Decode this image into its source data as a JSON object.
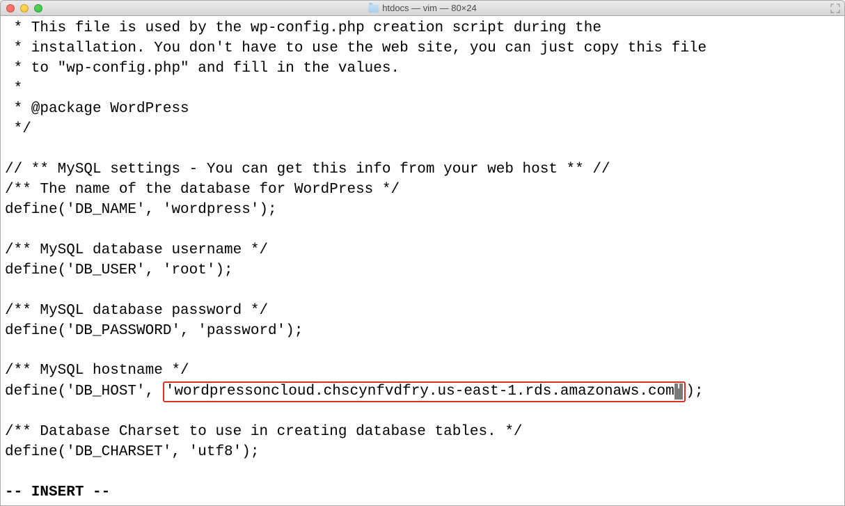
{
  "window": {
    "title_folder": "htdocs",
    "title_rest": " — vim — 80×24"
  },
  "lines": {
    "l1": " * This file is used by the wp-config.php creation script during the",
    "l2": " * installation. You don't have to use the web site, you can just copy this file",
    "l3": " * to \"wp-config.php\" and fill in the values.",
    "l4": " *",
    "l5": " * @package WordPress",
    "l6": " */",
    "l7": "",
    "l8": "// ** MySQL settings - You can get this info from your web host ** //",
    "l9": "/** The name of the database for WordPress */",
    "l10": "define('DB_NAME', 'wordpress');",
    "l11": "",
    "l12": "/** MySQL database username */",
    "l13": "define('DB_USER', 'root');",
    "l14": "",
    "l15": "/** MySQL database password */",
    "l16": "define('DB_PASSWORD', 'password');",
    "l17": "",
    "l18": "/** MySQL hostname */",
    "l19_a": "define('DB_HOST', ",
    "l19_box_a": "'wordpressoncloud.chscynfvdfry.us-east-1.rds.amazonaws.com",
    "l19_cursor": "'",
    "l19_c": ");",
    "l20": "",
    "l21": "/** Database Charset to use in creating database tables. */",
    "l22": "define('DB_CHARSET', 'utf8');",
    "l23": "",
    "l24": "-- INSERT --"
  }
}
